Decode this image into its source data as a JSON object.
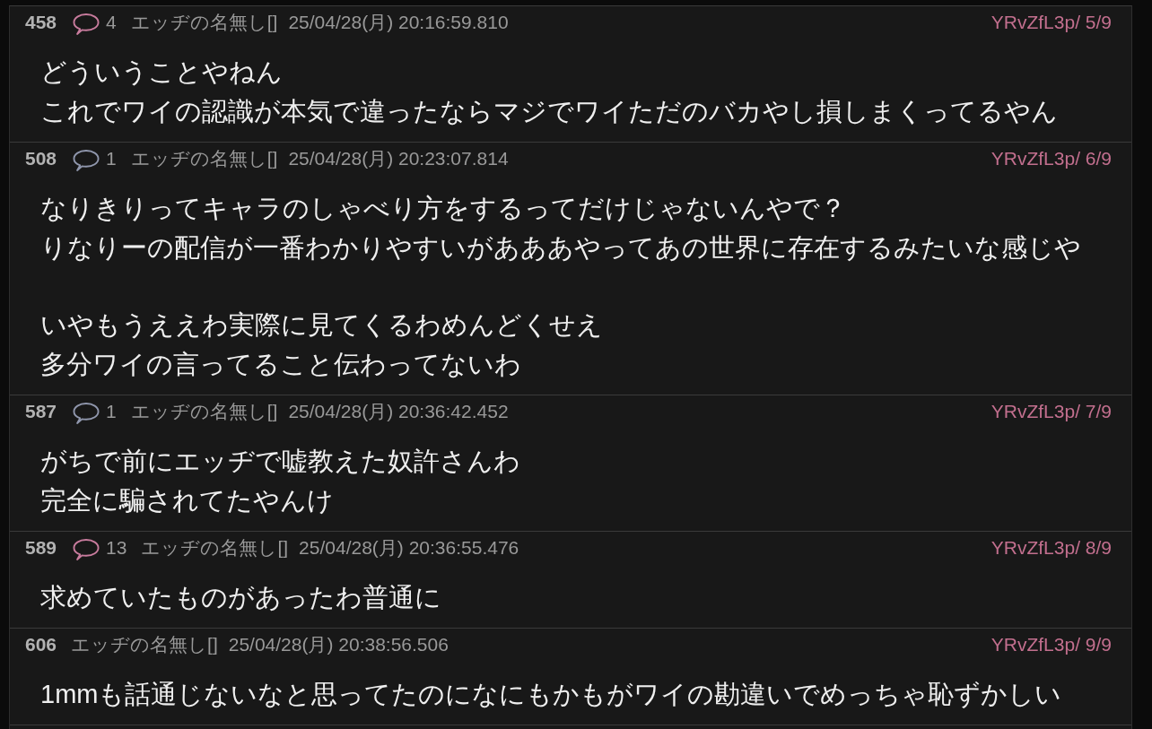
{
  "posts": [
    {
      "number": "458",
      "replies": {
        "count": "4",
        "color": "#c97c9e"
      },
      "name": "エッヂの名無し[]",
      "date": "25/04/28(月) 20:16:59.810",
      "id": "YRvZfL3p/ 5/9",
      "paragraphs": [
        [
          "どういうことやねん",
          "これでワイの認識が本気で違ったならマジでワイただのバカやし損しまくってるやん"
        ]
      ]
    },
    {
      "number": "508",
      "replies": {
        "count": "1",
        "color": "#9097ad"
      },
      "name": "エッヂの名無し[]",
      "date": "25/04/28(月) 20:23:07.814",
      "id": "YRvZfL3p/ 6/9",
      "paragraphs": [
        [
          "なりきりってキャラのしゃべり方をするってだけじゃないんやで？",
          "りなりーの配信が一番わかりやすいがあああやってあの世界に存在するみたいな感じや"
        ],
        [
          "いやもうええわ実際に見てくるわめんどくせえ",
          "多分ワイの言ってること伝わってないわ"
        ]
      ]
    },
    {
      "number": "587",
      "replies": {
        "count": "1",
        "color": "#9097ad"
      },
      "name": "エッヂの名無し[]",
      "date": "25/04/28(月) 20:36:42.452",
      "id": "YRvZfL3p/ 7/9",
      "paragraphs": [
        [
          "がちで前にエッヂで嘘教えた奴許さんわ",
          "完全に騙されてたやんけ"
        ]
      ]
    },
    {
      "number": "589",
      "replies": {
        "count": "13",
        "color": "#c97c9e"
      },
      "name": "エッヂの名無し[]",
      "date": "25/04/28(月) 20:36:55.476",
      "id": "YRvZfL3p/ 8/9",
      "paragraphs": [
        [
          "求めていたものがあったわ普通に"
        ]
      ]
    },
    {
      "number": "606",
      "name": "エッヂの名無し[]",
      "date": "25/04/28(月) 20:38:56.506",
      "id": "YRvZfL3p/ 9/9",
      "paragraphs": [
        [
          "1mmも話通じないなと思ってたのになにもかもがワイの勘違いでめっちゃ恥ずかしい"
        ]
      ]
    }
  ]
}
